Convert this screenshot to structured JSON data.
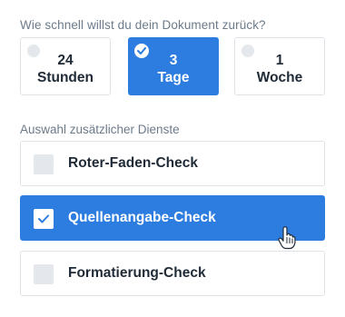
{
  "delivery": {
    "question": "Wie schnell willst du dein Dokument zurück?",
    "options": [
      {
        "line1": "24",
        "line2": "Stunden",
        "selected": false
      },
      {
        "line1": "3",
        "line2": "Tage",
        "selected": true
      },
      {
        "line1": "1",
        "line2": "Woche",
        "selected": false
      }
    ]
  },
  "services": {
    "label": "Auswahl zusätzlicher Dienste",
    "items": [
      {
        "label": "Roter-Faden-Check",
        "checked": false
      },
      {
        "label": "Quellenangabe-Check",
        "checked": true
      },
      {
        "label": "Formatierung-Check",
        "checked": false
      }
    ]
  },
  "colors": {
    "accent": "#2d7de0",
    "muted_text": "#6c7b8a",
    "dark_text": "#1f2a36",
    "border": "#dfe3e8",
    "unchecked_fill": "#e4e7eb"
  },
  "icons": {
    "cursor": "hand-pointer-icon",
    "check": "checkmark-icon"
  }
}
